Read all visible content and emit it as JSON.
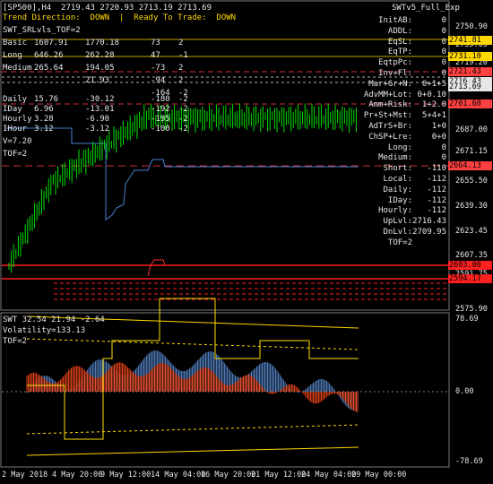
{
  "chart_header": {
    "symbol_info": "[SP500],H4  2719.43 2720.93 2713.19 2713.69",
    "ea_name": "SWTv5_Full_Exp",
    "trend": "Trend Direction:  DOWN  |  Ready To Trade:  DOWN"
  },
  "indicator_labels": {
    "srl": "SWT_SRLvls_TOF=2",
    "v": "V=7.20",
    "tof": "TOF=2"
  },
  "level_table": [
    {
      "name": "Basic",
      "a": "1607.91",
      "b": "1770.18",
      "c": "73",
      "d": "2"
    },
    {
      "name": "Long",
      "a": "646.26",
      "b": "262.28",
      "c": "47",
      "d": "-1"
    },
    {
      "name": "Medium",
      "a": "265.64",
      "b": "194.05",
      "c": "-73",
      "d": "2"
    },
    {
      "name": "",
      "a": "",
      "b": "21.93",
      "c": "-94",
      "d": "2"
    },
    {
      "name": "",
      "a": "",
      "b": "",
      "c": "-164",
      "d": "-2"
    },
    {
      "name": "Daily",
      "a": "15.76",
      "b": "-30.12",
      "c": "-180",
      "d": "-2"
    },
    {
      "name": "IDay",
      "a": "6.96",
      "b": "-13.01",
      "c": "-192",
      "d": "-2"
    },
    {
      "name": "Hourly",
      "a": "3.28",
      "b": "-6.90",
      "c": "-195",
      "d": "-2"
    },
    {
      "name": "IHour",
      "a": "3.12",
      "b": "-3.12",
      "c": "-100",
      "d": "-2"
    }
  ],
  "right_panel": [
    {
      "label": "InitAB:",
      "value": "0"
    },
    {
      "label": "ADDL:",
      "value": "0"
    },
    {
      "label": "EqSL:",
      "value": "0"
    },
    {
      "label": "EqTP:",
      "value": "0"
    },
    {
      "label": "EqtpPc:",
      "value": "0"
    },
    {
      "label": "Inv+Fl:",
      "value": "0"
    },
    {
      "label": "Mar+Gr+N:",
      "value": "0+1+5"
    },
    {
      "label": "AdvMM+Lot:",
      "value": "0+0.10"
    },
    {
      "label": "Amm+Risk:",
      "value": "1+2.0"
    },
    {
      "label": "Pr+St+Mst:",
      "value": "5+4+1"
    },
    {
      "label": "AdTrS+Br:",
      "value": "1+0"
    },
    {
      "label": "ChSP+Lre:",
      "value": "0+0"
    },
    {
      "label": "Long:",
      "value": "0"
    },
    {
      "label": "Medium:",
      "value": "0"
    },
    {
      "label": "Short:",
      "value": "-110"
    },
    {
      "label": "Local:",
      "value": "-112"
    },
    {
      "label": "Daily:",
      "value": "-112"
    },
    {
      "label": "IDay:",
      "value": "-112"
    },
    {
      "label": "Hourly:",
      "value": "-112"
    },
    {
      "label": "UpLvl:",
      "value": "2716.43"
    },
    {
      "label": "DnLvl:",
      "value": "2709.95"
    },
    {
      "label": "TOF=2",
      "value": ""
    }
  ],
  "price_axis": {
    "ticks": [
      "2750.90",
      "2735.05",
      "2719.20",
      "2703.35",
      "2687.00",
      "2671.15",
      "2655.50",
      "2639.30",
      "2623.45",
      "2607.35",
      "2591.75",
      "2575.90"
    ],
    "tags": [
      {
        "text": "2741.81",
        "color": "#ffd700"
      },
      {
        "text": "2731.10",
        "color": "#ffd700"
      },
      {
        "text": "2721.43",
        "color": "#ff4040"
      },
      {
        "text": "2716.43",
        "color": "#e6e6e6"
      },
      {
        "text": "2713.69",
        "color": "#e6e6e6"
      },
      {
        "text": "2701.60",
        "color": "#ff4040"
      },
      {
        "text": "2664.13",
        "color": "#ff4040"
      },
      {
        "text": "2603.00",
        "color": "#ff2020"
      },
      {
        "text": "2594.17",
        "color": "#ff2020"
      }
    ]
  },
  "oscillator": {
    "title": "SWT 32.54 21.94 -2.64",
    "volatility": "Volatility=133.13",
    "tof": "TOF=2",
    "axis": [
      "78.69",
      "0.00",
      "-78.69"
    ]
  },
  "time_axis": [
    "2 May 2018",
    "4 May 20:00",
    "9 May 12:00",
    "14 May 04:00",
    "16 May 20:00",
    "21 May 12:00",
    "24 May 04:00",
    "29 May 00:00"
  ]
}
